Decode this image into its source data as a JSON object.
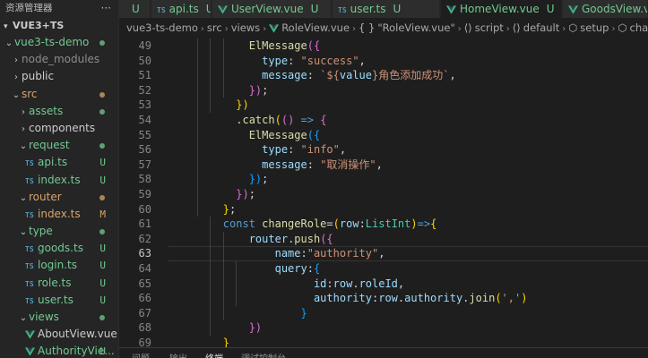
{
  "explorer": {
    "title": "资源管理器",
    "more": "···",
    "project": "VUE3+TS"
  },
  "tree": [
    {
      "label": "vue3-ts-demo",
      "kind": "folder",
      "depth": 0,
      "status": "dot",
      "color": "green",
      "expanded": true
    },
    {
      "label": "node_modules",
      "kind": "folder",
      "depth": 1,
      "status": "",
      "color": "gray",
      "expanded": false
    },
    {
      "label": "public",
      "kind": "folder",
      "depth": 1,
      "status": "",
      "color": "white",
      "expanded": false
    },
    {
      "label": "src",
      "kind": "folder",
      "depth": 1,
      "status": "dot",
      "color": "brown",
      "expanded": true
    },
    {
      "label": "assets",
      "kind": "folder",
      "depth": 2,
      "status": "dot",
      "color": "green",
      "expanded": false
    },
    {
      "label": "components",
      "kind": "folder",
      "depth": 2,
      "status": "",
      "color": "white",
      "expanded": false
    },
    {
      "label": "request",
      "kind": "folder",
      "depth": 2,
      "status": "dot",
      "color": "green",
      "expanded": true
    },
    {
      "label": "api.ts",
      "kind": "ts",
      "depth": 3,
      "status": "U",
      "color": "green"
    },
    {
      "label": "index.ts",
      "kind": "ts",
      "depth": 3,
      "status": "U",
      "color": "green"
    },
    {
      "label": "router",
      "kind": "folder",
      "depth": 2,
      "status": "dot",
      "color": "brown",
      "expanded": true
    },
    {
      "label": "index.ts",
      "kind": "ts",
      "depth": 3,
      "status": "M",
      "color": "brown"
    },
    {
      "label": "type",
      "kind": "folder",
      "depth": 2,
      "status": "dot",
      "color": "green",
      "expanded": true
    },
    {
      "label": "goods.ts",
      "kind": "ts",
      "depth": 3,
      "status": "U",
      "color": "green"
    },
    {
      "label": "login.ts",
      "kind": "ts",
      "depth": 3,
      "status": "U",
      "color": "green"
    },
    {
      "label": "role.ts",
      "kind": "ts",
      "depth": 3,
      "status": "U",
      "color": "green"
    },
    {
      "label": "user.ts",
      "kind": "ts",
      "depth": 3,
      "status": "U",
      "color": "green"
    },
    {
      "label": "views",
      "kind": "folder",
      "depth": 2,
      "status": "dot",
      "color": "green",
      "expanded": true
    },
    {
      "label": "AboutView.vue",
      "kind": "vue",
      "depth": 3,
      "status": "",
      "color": "white"
    },
    {
      "label": "AuthorityVie...",
      "kind": "vue",
      "depth": 3,
      "status": "U",
      "color": "green"
    }
  ],
  "tabs": [
    {
      "label": "",
      "kind": "none",
      "badge": "U"
    },
    {
      "label": "api.ts",
      "kind": "ts",
      "badge": "U"
    },
    {
      "label": "UserView.vue",
      "kind": "vue",
      "badge": "U"
    },
    {
      "label": "user.ts",
      "kind": "ts",
      "badge": "U"
    },
    {
      "label": "HomeView.vue",
      "kind": "vue",
      "badge": "U"
    },
    {
      "label": "GoodsView.vu",
      "kind": "vue",
      "badge": ""
    }
  ],
  "breadcrumb": {
    "parts": [
      "vue3-ts-demo",
      "src",
      "views",
      "RoleView.vue",
      "\"RoleView.vue\"",
      "script",
      "default",
      "setup",
      "changeR"
    ],
    "icons": {
      "braces": "{ }",
      "script": "⟨⟩",
      "default": "⟨⟩",
      "setup": "⬡",
      "changeR": "⬡"
    }
  },
  "editor": {
    "active_line": 63,
    "lines": [
      {
        "n": 49,
        "indent": 6,
        "code": [
          [
            "f",
            "ElMessage"
          ],
          [
            "b2",
            "({"
          ]
        ]
      },
      {
        "n": 50,
        "indent": 7,
        "code": [
          [
            "v",
            "type"
          ],
          [
            "p",
            ": "
          ],
          [
            "s",
            "\"success\""
          ],
          [
            "p",
            ","
          ]
        ]
      },
      {
        "n": 51,
        "indent": 7,
        "code": [
          [
            "v",
            "message"
          ],
          [
            "p",
            ": "
          ],
          [
            "s",
            "`${"
          ],
          [
            "v",
            "value"
          ],
          [
            "s",
            "}角色添加成功`"
          ],
          [
            "p",
            ","
          ]
        ]
      },
      {
        "n": 52,
        "indent": 6,
        "code": [
          [
            "b2",
            "})"
          ],
          [
            "p",
            ";"
          ]
        ]
      },
      {
        "n": 53,
        "indent": 5,
        "code": [
          [
            "b1",
            "})"
          ]
        ]
      },
      {
        "n": 54,
        "indent": 5,
        "code": [
          [
            "p",
            "."
          ],
          [
            "f",
            "catch"
          ],
          [
            "b1",
            "("
          ],
          [
            "b2",
            "()"
          ],
          [
            "p",
            " "
          ],
          [
            "k",
            "=>"
          ],
          [
            "p",
            " "
          ],
          [
            "b2",
            "{"
          ]
        ]
      },
      {
        "n": 55,
        "indent": 6,
        "code": [
          [
            "f",
            "ElMessage"
          ],
          [
            "b3",
            "({"
          ]
        ]
      },
      {
        "n": 56,
        "indent": 7,
        "code": [
          [
            "v",
            "type"
          ],
          [
            "p",
            ": "
          ],
          [
            "s",
            "\"info\""
          ],
          [
            "p",
            ","
          ]
        ]
      },
      {
        "n": 57,
        "indent": 7,
        "code": [
          [
            "v",
            "message"
          ],
          [
            "p",
            ": "
          ],
          [
            "s",
            "\"取消操作\""
          ],
          [
            "p",
            ","
          ]
        ]
      },
      {
        "n": 58,
        "indent": 6,
        "code": [
          [
            "b3",
            "})"
          ],
          [
            "p",
            ";"
          ]
        ]
      },
      {
        "n": 59,
        "indent": 5,
        "code": [
          [
            "b2",
            "})"
          ],
          [
            "p",
            ";"
          ]
        ]
      },
      {
        "n": 60,
        "indent": 4,
        "code": [
          [
            "b1",
            "}"
          ],
          [
            "p",
            ";"
          ]
        ]
      },
      {
        "n": 61,
        "indent": 4,
        "code": [
          [
            "k",
            "const"
          ],
          [
            "p",
            " "
          ],
          [
            "f",
            "changeRole"
          ],
          [
            "p",
            "="
          ],
          [
            "b1",
            "("
          ],
          [
            "v",
            "row"
          ],
          [
            "p",
            ":"
          ],
          [
            "t",
            "ListInt"
          ],
          [
            "b1",
            ")"
          ],
          [
            "k",
            "=>"
          ],
          [
            "b1",
            "{"
          ]
        ]
      },
      {
        "n": 62,
        "indent": 6,
        "code": [
          [
            "v",
            "router"
          ],
          [
            "p",
            "."
          ],
          [
            "f",
            "push"
          ],
          [
            "b2",
            "({"
          ]
        ]
      },
      {
        "n": 63,
        "indent": 8,
        "code": [
          [
            "v",
            "name"
          ],
          [
            "p",
            ":"
          ],
          [
            "s",
            "\"authority\""
          ],
          [
            "p",
            ","
          ]
        ]
      },
      {
        "n": 64,
        "indent": 8,
        "code": [
          [
            "v",
            "query"
          ],
          [
            "p",
            ":"
          ],
          [
            "b3",
            "{"
          ]
        ]
      },
      {
        "n": 65,
        "indent": 11,
        "code": [
          [
            "v",
            "id"
          ],
          [
            "p",
            ":"
          ],
          [
            "v",
            "row"
          ],
          [
            "p",
            "."
          ],
          [
            "v",
            "roleId"
          ],
          [
            "p",
            ","
          ]
        ]
      },
      {
        "n": 66,
        "indent": 11,
        "code": [
          [
            "v",
            "authority"
          ],
          [
            "p",
            ":"
          ],
          [
            "v",
            "row"
          ],
          [
            "p",
            "."
          ],
          [
            "v",
            "authority"
          ],
          [
            "p",
            "."
          ],
          [
            "f",
            "join"
          ],
          [
            "b1",
            "("
          ],
          [
            "s",
            "','"
          ],
          [
            "b1",
            ")"
          ]
        ]
      },
      {
        "n": 67,
        "indent": 10,
        "code": [
          [
            "b3",
            "}"
          ]
        ]
      },
      {
        "n": 68,
        "indent": 6,
        "code": [
          [
            "b2",
            "})"
          ]
        ]
      },
      {
        "n": 69,
        "indent": 4,
        "code": [
          [
            "b1",
            "}"
          ]
        ]
      }
    ]
  },
  "panel": {
    "tabs": [
      "问题",
      "输出",
      "终端",
      "调试控制台"
    ]
  },
  "colors": {
    "green": "#73c991",
    "brown": "#d7a56a",
    "vue": "#41b883"
  }
}
